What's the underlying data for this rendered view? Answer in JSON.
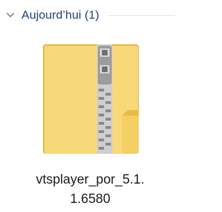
{
  "group": {
    "title": "Aujourd’hui (1)",
    "expanded": true
  },
  "file": {
    "name_line1": "vtsplayer_por_5.1.",
    "name_line2": "1.6580",
    "icon": "zip-folder-icon"
  },
  "colors": {
    "group_title": "#1e3f78",
    "folder_back": "#e9b93c",
    "folder_front": "#f6d877",
    "zipper": "#9a9a9a"
  }
}
